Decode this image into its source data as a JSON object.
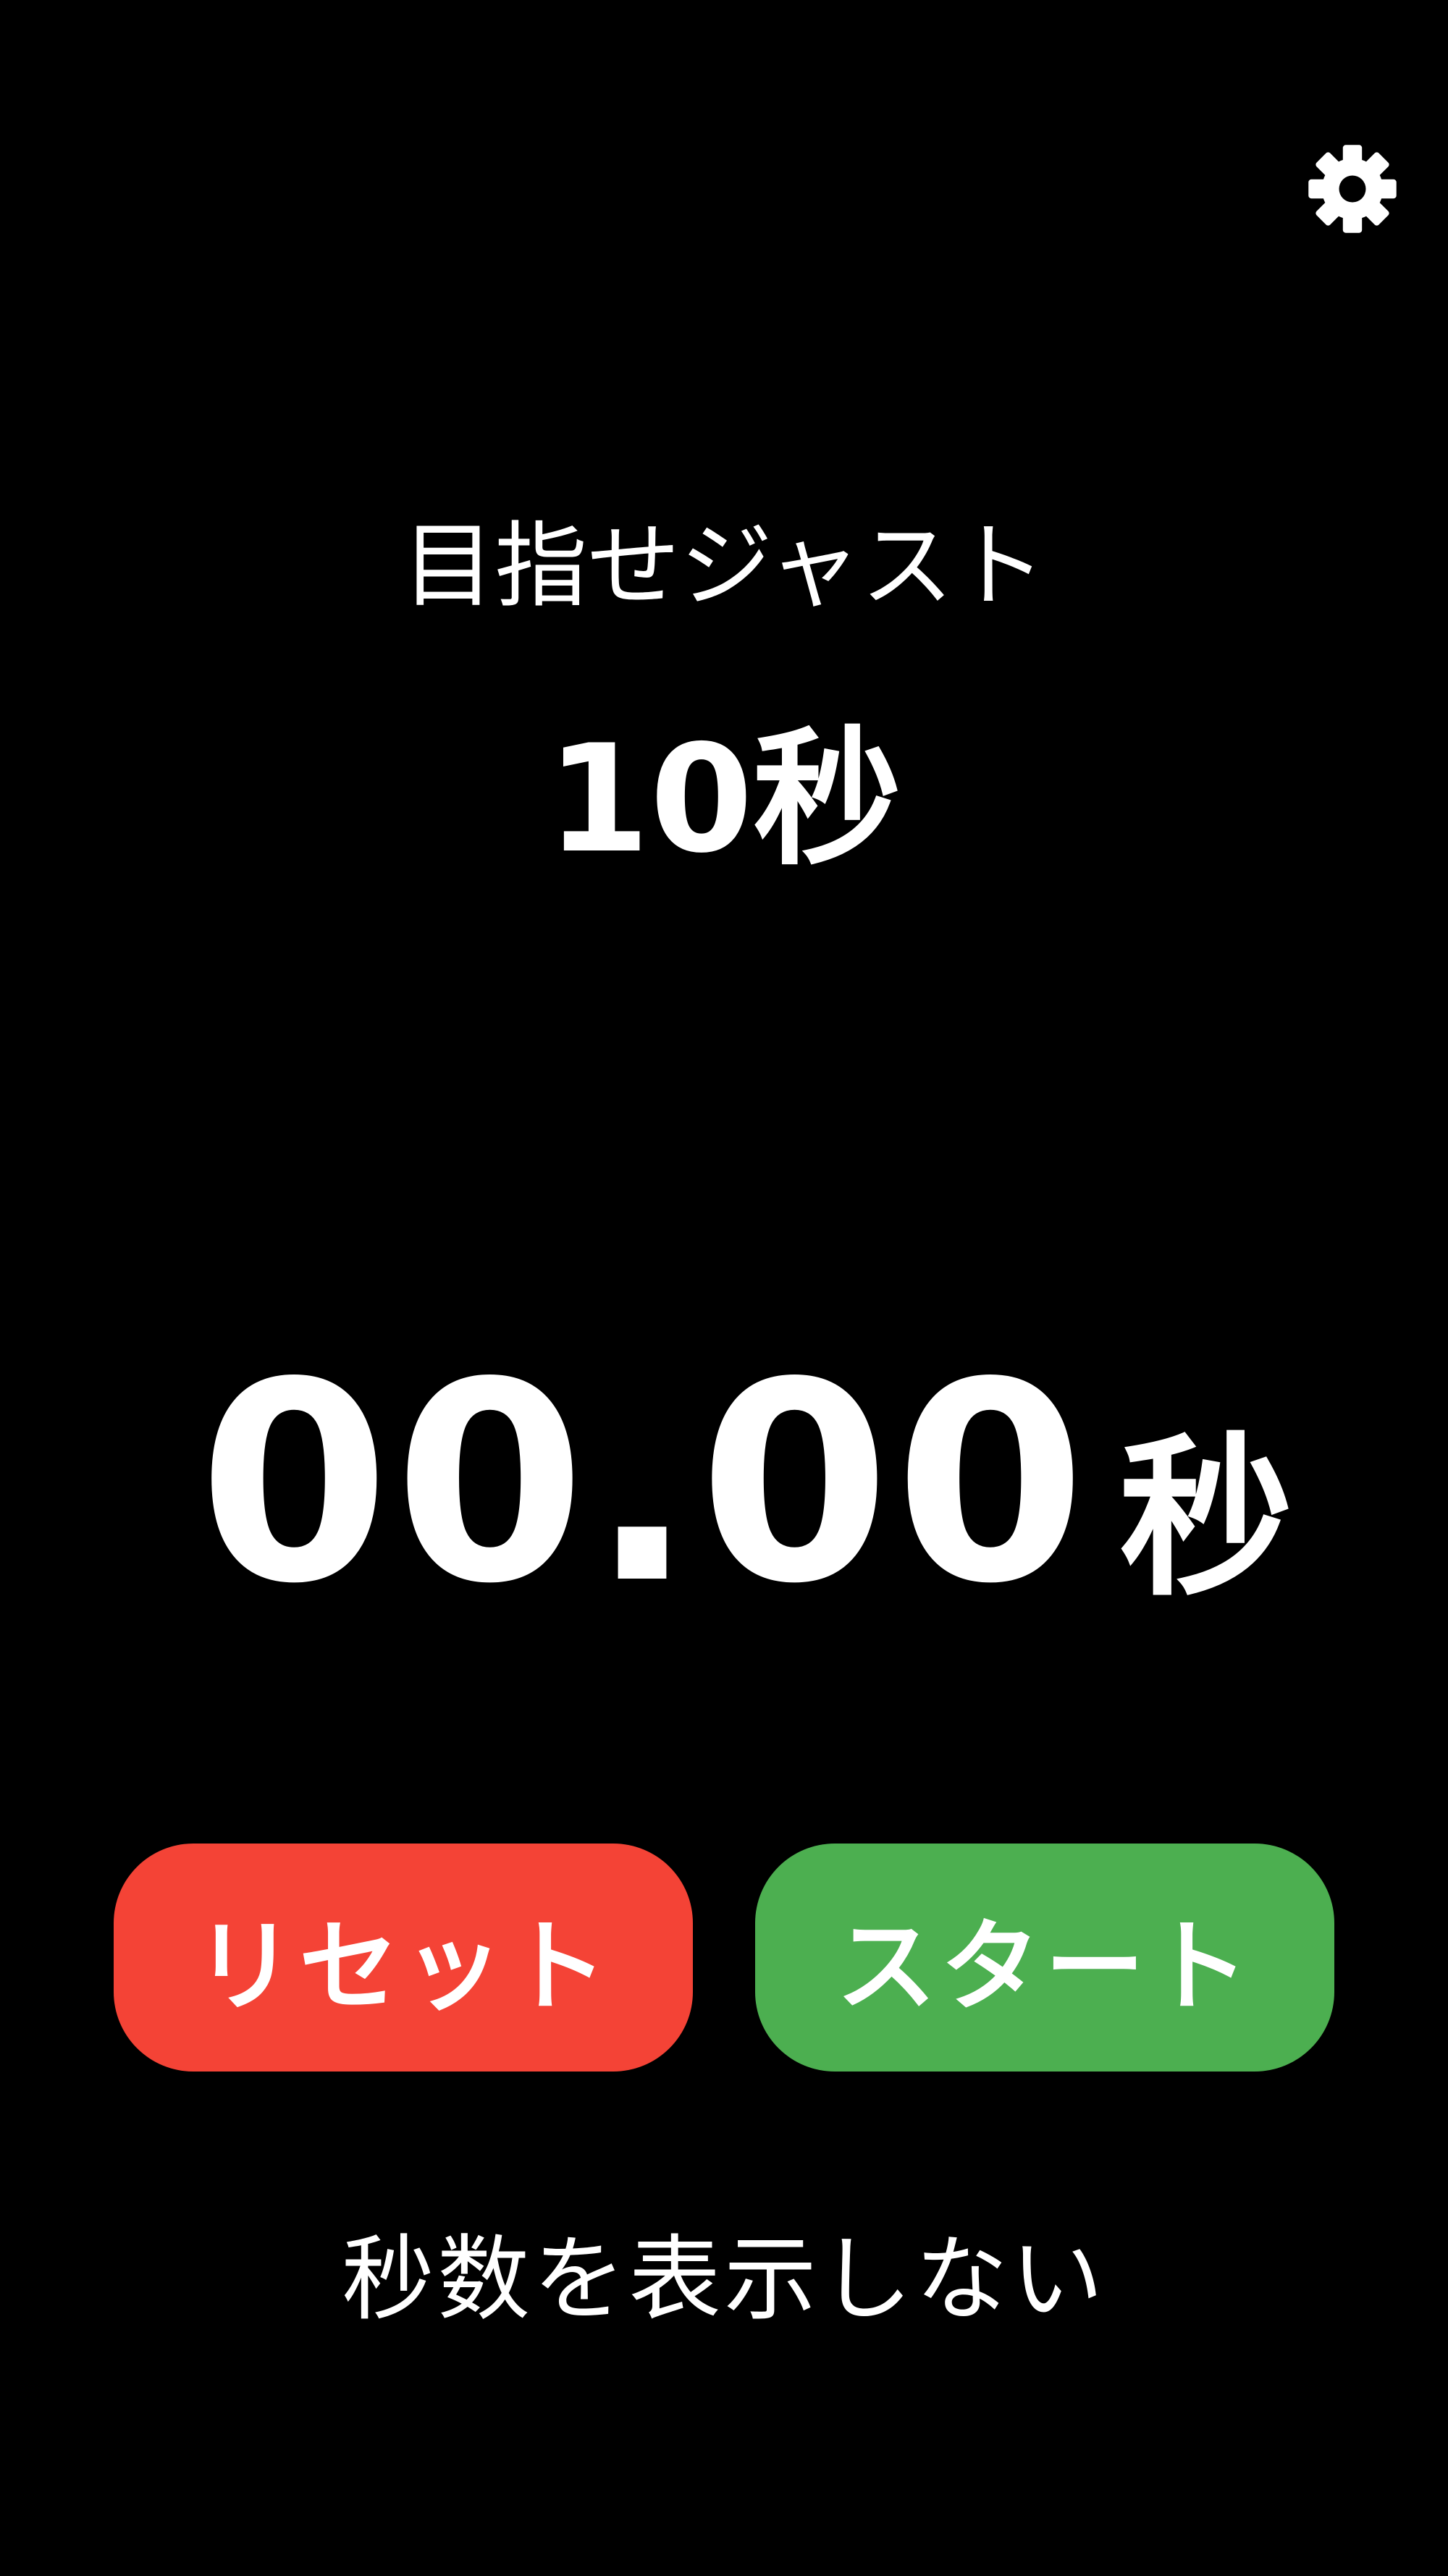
{
  "header": {
    "settings_icon": "gear-icon"
  },
  "target": {
    "label": "目指せジャスト",
    "value": "10秒"
  },
  "timer": {
    "value": "00.00",
    "unit": "秒"
  },
  "buttons": {
    "reset_label": "リセット",
    "start_label": "スタート",
    "reset_color": "#f44336",
    "start_color": "#4caf50"
  },
  "toggle": {
    "hide_seconds_label": "秒数を表示しない"
  },
  "colors": {
    "background": "#000000",
    "text": "#ffffff"
  }
}
